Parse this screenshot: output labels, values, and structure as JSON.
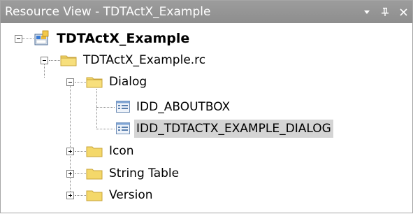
{
  "window": {
    "title": "Resource View - TDTActX_Example",
    "buttons": {
      "dropdown": "▾",
      "pin": "Ⅎ",
      "close": "✕"
    }
  },
  "tree": {
    "project": "TDTActX_Example",
    "rc_file": "TDTActX_Example.rc",
    "dialog_folder": "Dialog",
    "dialogs": [
      "IDD_ABOUTBOX",
      "IDD_TDTACTX_EXAMPLE_DIALOG"
    ],
    "folders": [
      "Icon",
      "String Table",
      "Version"
    ]
  },
  "colors": {
    "title_bar": "#9c9c9c",
    "selection": "#d4d4d4",
    "folder": "#f2d35e"
  }
}
